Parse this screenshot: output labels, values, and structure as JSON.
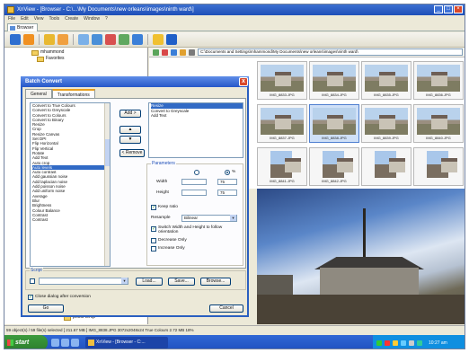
{
  "app": {
    "title": "XnView - [Browser - C:\\...\\My Documents\\new orleans\\images\\ninth ward\\]",
    "menu": [
      "File",
      "Edit",
      "View",
      "Tools",
      "Create",
      "Window",
      "?"
    ],
    "browser_tab": "Browser",
    "address": "C:\\Documents and Settings\\mhammond\\My Documents\\new orleans\\images\\ninth ward\\"
  },
  "tree": {
    "top_items": [
      "mhammond",
      "Favorites"
    ],
    "bottom_items": [
      "maps",
      "photo temp"
    ]
  },
  "thumbnails": [
    {
      "caption": "IMG_8833.JPG"
    },
    {
      "caption": "IMG_8834.JPG"
    },
    {
      "caption": "IMG_8835.JPG"
    },
    {
      "caption": "IMG_8836.JPG"
    },
    {
      "caption": "IMG_8837.JPG"
    },
    {
      "caption": "IMG_8838.JPG"
    },
    {
      "caption": "IMG_8839.JPG"
    },
    {
      "caption": "IMG_8840.JPG"
    },
    {
      "caption": "IMG_8841.JPG"
    },
    {
      "caption": "IMG_8842.JPG"
    }
  ],
  "status": "59 object(s) / 59 file(s) selected  [ 211.67 MB ]   IMG_8838.JPG   3072x2048x24   True Colours   2.72 MB   18%",
  "taskbar": {
    "start": "start",
    "task": "XnView - [Browser - C:...",
    "clock": "10:27 am"
  },
  "dialog": {
    "title": "Batch Convert",
    "close": "x",
    "tabs": [
      "General",
      "Transformations"
    ],
    "transformations": [
      "Convert to True Colours",
      "Convert to Greyscale",
      "Convert to Colours",
      "Convert to Binary",
      "Resize",
      "Crop",
      "Resize Canvas",
      "Set DPI",
      "Flip Horizontal",
      "Flip Vertical",
      "Rotate",
      "Add Text",
      "Auto crop",
      "Auto levels",
      "Auto contrast",
      "Add gaussian noise",
      "Add laplacian noise",
      "Add poisson noise",
      "Add uniform noise",
      "Average",
      "Blur",
      "Brightness",
      "Colour Balance",
      "Contrast",
      "Contrast"
    ],
    "selected_index": 13,
    "buttons": {
      "add": "Add >",
      "up": "▲",
      "down": "▼",
      "remove": "< Remove",
      "load": "Load...",
      "save": "Save...",
      "browse": "Browse...",
      "go": "Go",
      "cancel": "Cancel"
    },
    "applied": [
      "Resize",
      "Convert to Greyscale",
      "Add Text"
    ],
    "applied_selected": 0,
    "parameters": {
      "legend": "Parameters",
      "radio_left": "",
      "radio_right": "%",
      "width_label": "Width",
      "width_value": "75",
      "height_label": "Height",
      "height_value": "75",
      "keep_ratio": "Keep ratio",
      "resample_label": "Resample",
      "resample_value": "Bilinear",
      "switch_label": "Switch Width and Height to follow orientation",
      "decrease_only": "Decrease Only",
      "increase_only": "Increase Only"
    },
    "script_legend": "Script",
    "close_after": "Close dialog after conversion"
  }
}
